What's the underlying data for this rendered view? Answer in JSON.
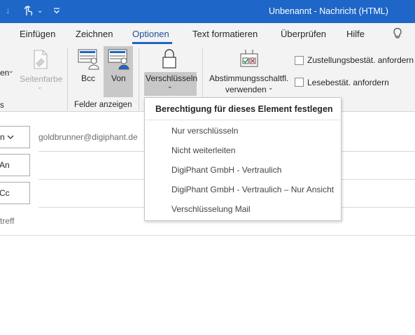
{
  "window": {
    "title": "Unbenannt  -  Nachricht (HTML)"
  },
  "tabs": [
    "Einfügen",
    "Zeichnen",
    "Optionen",
    "Text formatieren",
    "Überprüfen",
    "Hilfe"
  ],
  "active_tab": "Optionen",
  "ribbon": {
    "themes_partial_label": "en",
    "page_color_label": "Seitenfarbe",
    "themes_group_partial": "s",
    "bcc_label": "Bcc",
    "von_label": "Von",
    "show_fields_group": "Felder anzeigen",
    "encrypt_label": "Verschlüsseln",
    "voting_label_line1": "Abstimmungsschaltfl.",
    "voting_label_line2": "verwenden",
    "delivery_receipt_label": "Zustellungsbestät. anfordern",
    "read_receipt_label": "Lesebestät. anfordern"
  },
  "compose": {
    "from_button": "n",
    "from_value": "goldbrunner@digiphant.de",
    "to_button": "An",
    "cc_button": "Cc",
    "subject_label": "treff"
  },
  "encrypt_menu": {
    "header": "Berechtigung für dieses Element festlegen",
    "items": [
      "Nur verschlüsseln",
      "Nicht weiterleiten",
      "DigiPhant GmbH - Vertraulich",
      "DigiPhant GmbH - Vertraulich – Nur Ansicht",
      "Verschlüsselung Mail"
    ]
  },
  "colors": {
    "titlebar": "#1e66c7",
    "ribbon": "#f3f3f3",
    "selected": "#c8c8c8"
  }
}
